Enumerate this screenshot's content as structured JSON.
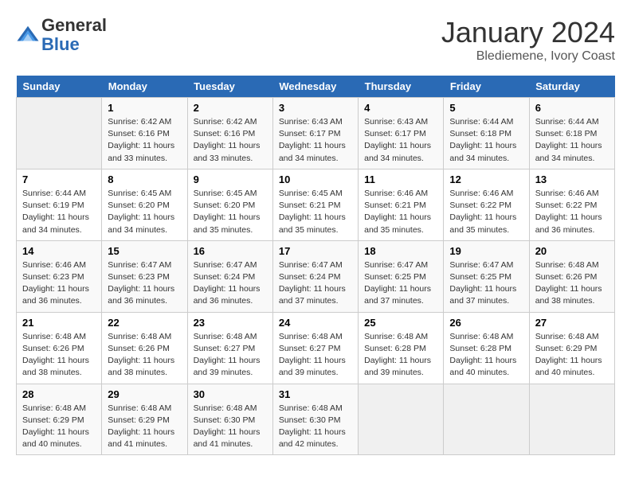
{
  "header": {
    "logo_general": "General",
    "logo_blue": "Blue",
    "month_title": "January 2024",
    "location": "Blediemene, Ivory Coast"
  },
  "weekdays": [
    "Sunday",
    "Monday",
    "Tuesday",
    "Wednesday",
    "Thursday",
    "Friday",
    "Saturday"
  ],
  "weeks": [
    [
      {
        "day": "",
        "sunrise": "",
        "sunset": "",
        "daylight": ""
      },
      {
        "day": "1",
        "sunrise": "Sunrise: 6:42 AM",
        "sunset": "Sunset: 6:16 PM",
        "daylight": "Daylight: 11 hours and 33 minutes."
      },
      {
        "day": "2",
        "sunrise": "Sunrise: 6:42 AM",
        "sunset": "Sunset: 6:16 PM",
        "daylight": "Daylight: 11 hours and 33 minutes."
      },
      {
        "day": "3",
        "sunrise": "Sunrise: 6:43 AM",
        "sunset": "Sunset: 6:17 PM",
        "daylight": "Daylight: 11 hours and 34 minutes."
      },
      {
        "day": "4",
        "sunrise": "Sunrise: 6:43 AM",
        "sunset": "Sunset: 6:17 PM",
        "daylight": "Daylight: 11 hours and 34 minutes."
      },
      {
        "day": "5",
        "sunrise": "Sunrise: 6:44 AM",
        "sunset": "Sunset: 6:18 PM",
        "daylight": "Daylight: 11 hours and 34 minutes."
      },
      {
        "day": "6",
        "sunrise": "Sunrise: 6:44 AM",
        "sunset": "Sunset: 6:18 PM",
        "daylight": "Daylight: 11 hours and 34 minutes."
      }
    ],
    [
      {
        "day": "7",
        "sunrise": "Sunrise: 6:44 AM",
        "sunset": "Sunset: 6:19 PM",
        "daylight": "Daylight: 11 hours and 34 minutes."
      },
      {
        "day": "8",
        "sunrise": "Sunrise: 6:45 AM",
        "sunset": "Sunset: 6:20 PM",
        "daylight": "Daylight: 11 hours and 34 minutes."
      },
      {
        "day": "9",
        "sunrise": "Sunrise: 6:45 AM",
        "sunset": "Sunset: 6:20 PM",
        "daylight": "Daylight: 11 hours and 35 minutes."
      },
      {
        "day": "10",
        "sunrise": "Sunrise: 6:45 AM",
        "sunset": "Sunset: 6:21 PM",
        "daylight": "Daylight: 11 hours and 35 minutes."
      },
      {
        "day": "11",
        "sunrise": "Sunrise: 6:46 AM",
        "sunset": "Sunset: 6:21 PM",
        "daylight": "Daylight: 11 hours and 35 minutes."
      },
      {
        "day": "12",
        "sunrise": "Sunrise: 6:46 AM",
        "sunset": "Sunset: 6:22 PM",
        "daylight": "Daylight: 11 hours and 35 minutes."
      },
      {
        "day": "13",
        "sunrise": "Sunrise: 6:46 AM",
        "sunset": "Sunset: 6:22 PM",
        "daylight": "Daylight: 11 hours and 36 minutes."
      }
    ],
    [
      {
        "day": "14",
        "sunrise": "Sunrise: 6:46 AM",
        "sunset": "Sunset: 6:23 PM",
        "daylight": "Daylight: 11 hours and 36 minutes."
      },
      {
        "day": "15",
        "sunrise": "Sunrise: 6:47 AM",
        "sunset": "Sunset: 6:23 PM",
        "daylight": "Daylight: 11 hours and 36 minutes."
      },
      {
        "day": "16",
        "sunrise": "Sunrise: 6:47 AM",
        "sunset": "Sunset: 6:24 PM",
        "daylight": "Daylight: 11 hours and 36 minutes."
      },
      {
        "day": "17",
        "sunrise": "Sunrise: 6:47 AM",
        "sunset": "Sunset: 6:24 PM",
        "daylight": "Daylight: 11 hours and 37 minutes."
      },
      {
        "day": "18",
        "sunrise": "Sunrise: 6:47 AM",
        "sunset": "Sunset: 6:25 PM",
        "daylight": "Daylight: 11 hours and 37 minutes."
      },
      {
        "day": "19",
        "sunrise": "Sunrise: 6:47 AM",
        "sunset": "Sunset: 6:25 PM",
        "daylight": "Daylight: 11 hours and 37 minutes."
      },
      {
        "day": "20",
        "sunrise": "Sunrise: 6:48 AM",
        "sunset": "Sunset: 6:26 PM",
        "daylight": "Daylight: 11 hours and 38 minutes."
      }
    ],
    [
      {
        "day": "21",
        "sunrise": "Sunrise: 6:48 AM",
        "sunset": "Sunset: 6:26 PM",
        "daylight": "Daylight: 11 hours and 38 minutes."
      },
      {
        "day": "22",
        "sunrise": "Sunrise: 6:48 AM",
        "sunset": "Sunset: 6:26 PM",
        "daylight": "Daylight: 11 hours and 38 minutes."
      },
      {
        "day": "23",
        "sunrise": "Sunrise: 6:48 AM",
        "sunset": "Sunset: 6:27 PM",
        "daylight": "Daylight: 11 hours and 39 minutes."
      },
      {
        "day": "24",
        "sunrise": "Sunrise: 6:48 AM",
        "sunset": "Sunset: 6:27 PM",
        "daylight": "Daylight: 11 hours and 39 minutes."
      },
      {
        "day": "25",
        "sunrise": "Sunrise: 6:48 AM",
        "sunset": "Sunset: 6:28 PM",
        "daylight": "Daylight: 11 hours and 39 minutes."
      },
      {
        "day": "26",
        "sunrise": "Sunrise: 6:48 AM",
        "sunset": "Sunset: 6:28 PM",
        "daylight": "Daylight: 11 hours and 40 minutes."
      },
      {
        "day": "27",
        "sunrise": "Sunrise: 6:48 AM",
        "sunset": "Sunset: 6:29 PM",
        "daylight": "Daylight: 11 hours and 40 minutes."
      }
    ],
    [
      {
        "day": "28",
        "sunrise": "Sunrise: 6:48 AM",
        "sunset": "Sunset: 6:29 PM",
        "daylight": "Daylight: 11 hours and 40 minutes."
      },
      {
        "day": "29",
        "sunrise": "Sunrise: 6:48 AM",
        "sunset": "Sunset: 6:29 PM",
        "daylight": "Daylight: 11 hours and 41 minutes."
      },
      {
        "day": "30",
        "sunrise": "Sunrise: 6:48 AM",
        "sunset": "Sunset: 6:30 PM",
        "daylight": "Daylight: 11 hours and 41 minutes."
      },
      {
        "day": "31",
        "sunrise": "Sunrise: 6:48 AM",
        "sunset": "Sunset: 6:30 PM",
        "daylight": "Daylight: 11 hours and 42 minutes."
      },
      {
        "day": "",
        "sunrise": "",
        "sunset": "",
        "daylight": ""
      },
      {
        "day": "",
        "sunrise": "",
        "sunset": "",
        "daylight": ""
      },
      {
        "day": "",
        "sunrise": "",
        "sunset": "",
        "daylight": ""
      }
    ]
  ]
}
